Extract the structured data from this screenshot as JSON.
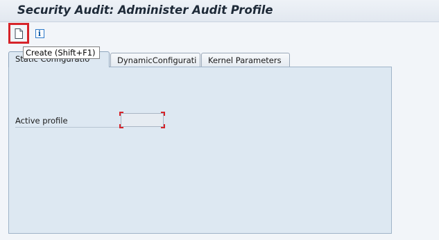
{
  "window": {
    "title": "Security Audit: Administer Audit Profile"
  },
  "toolbar": {
    "create_icon": "document-new-icon",
    "info_icon": "information-icon",
    "info_glyph": "i"
  },
  "tooltip": {
    "text": "Create   (Shift+F1)"
  },
  "tabs": [
    {
      "label": "Static Configuratio",
      "active": true
    },
    {
      "label": "DynamicConfigurati",
      "active": false
    },
    {
      "label": "Kernel Parameters",
      "active": false
    }
  ],
  "form": {
    "active_profile_label": "Active profile",
    "active_profile_value": ""
  },
  "colors": {
    "accent_highlight": "#d6242a",
    "tab_panel_bg": "#dde8f2",
    "title_text": "#1e2a38"
  }
}
